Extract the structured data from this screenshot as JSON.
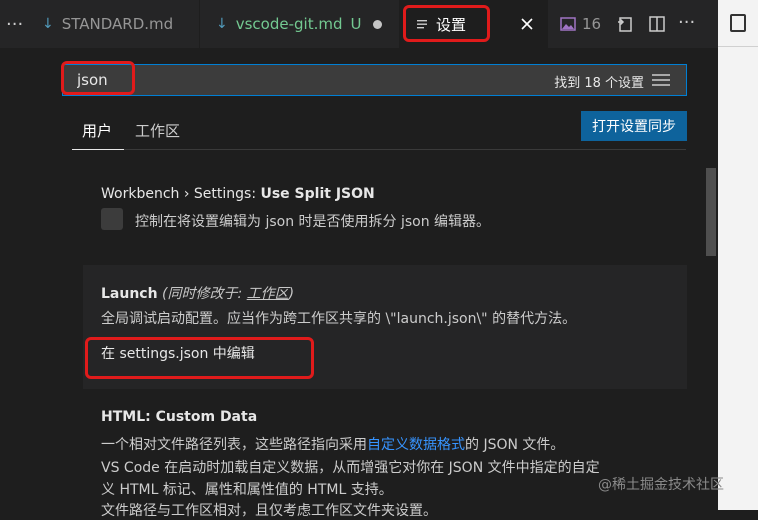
{
  "tabs": {
    "more": "···",
    "tab1": "STANDARD.md",
    "tab2": "vscode-git.md",
    "tab2_status": "U",
    "tab3": "设置",
    "tab4": "16"
  },
  "search": {
    "value": "json",
    "result_count": "找到 18 个设置"
  },
  "scope_tabs": {
    "user": "用户",
    "workspace": "工作区"
  },
  "sync_button": "打开设置同步",
  "settings": {
    "split_json": {
      "category": "Workbench › Settings: ",
      "name": "Use Split JSON",
      "description": "控制在将设置编辑为 json 时是否使用拆分 json 编辑器。"
    },
    "launch": {
      "name": "Launch",
      "modified_prefix": "(同时修改于: ",
      "modified_scope": "工作区",
      "modified_suffix": ")",
      "description": "全局调试启动配置。应当作为跨工作区共享的 \\\"launch.json\\\" 的替代方法。",
      "edit_link": "在 settings.json 中编辑"
    },
    "html_custom_data": {
      "category": "HTML: ",
      "name": "Custom Data",
      "line1_before": "一个相对文件路径列表，这些路径指向采用",
      "line1_link": "自定义数据格式",
      "line1_after": "的 JSON 文件。",
      "line2": "VS Code 在启动时加载自定义数据，从而增强它对你在 JSON 文件中指定的自定",
      "line3": "义 HTML 标记、属性和属性值的 HTML 支持。",
      "line4": "文件路径与工作区相对，且仅考虑工作区文件夹设置。"
    }
  },
  "watermark": "@稀土掘金技术社区",
  "colors": {
    "highlight": "#e01b1b",
    "accent": "#007fd4",
    "button": "#0e639c",
    "link": "#3794ff"
  },
  "icons": [
    "markdown-icon",
    "settings-file-icon",
    "close-icon",
    "image-icon",
    "open-changes-icon",
    "split-editor-icon",
    "more-actions-icon",
    "filter-icon"
  ]
}
